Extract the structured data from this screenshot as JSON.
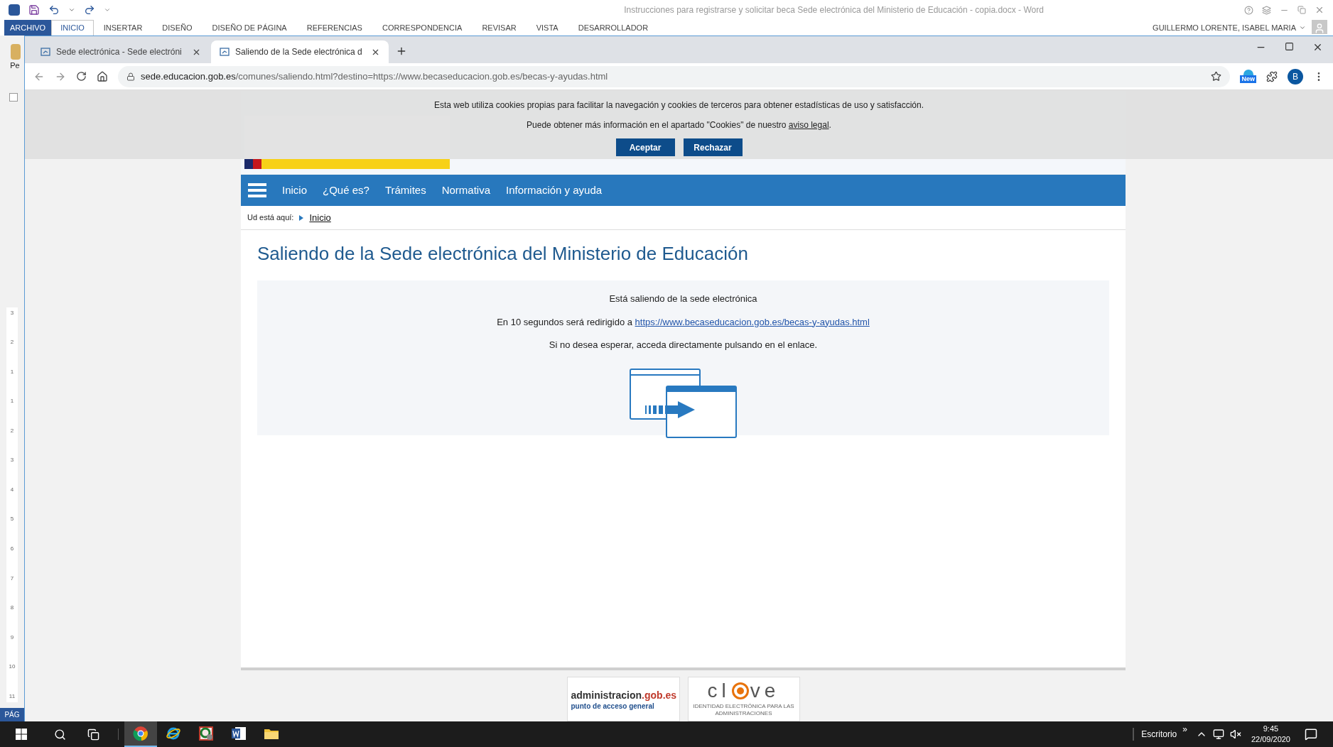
{
  "word": {
    "title": "Instrucciones para registrarse y solicitar beca Sede electrónica del Ministerio de Educación - copia.docx - Word",
    "ribbon_tabs": [
      {
        "label": "ARCHIVO",
        "kind": "file",
        "selected": false
      },
      {
        "label": "INICIO",
        "kind": "tab",
        "selected": true
      },
      {
        "label": "INSERTAR",
        "kind": "tab",
        "selected": false
      },
      {
        "label": "DISEÑO",
        "kind": "tab",
        "selected": false
      },
      {
        "label": "DISEÑO DE PÁGINA",
        "kind": "tab",
        "selected": false
      },
      {
        "label": "REFERENCIAS",
        "kind": "tab",
        "selected": false
      },
      {
        "label": "CORRESPONDENCIA",
        "kind": "tab",
        "selected": false
      },
      {
        "label": "REVISAR",
        "kind": "tab",
        "selected": false
      },
      {
        "label": "VISTA",
        "kind": "tab",
        "selected": false
      },
      {
        "label": "DESARROLLADOR",
        "kind": "tab",
        "selected": false
      }
    ],
    "user": "GUILLERMO LORENTE, ISABEL MARIA",
    "paste_label": "Pe",
    "ruler_marks": [
      "3",
      "2",
      "1",
      "1",
      "2",
      "3",
      "4",
      "5",
      "6",
      "7",
      "8",
      "9",
      "10",
      "11"
    ],
    "status": "PÁG"
  },
  "browser": {
    "tabs": [
      {
        "title": "Sede electrónica - Sede electróni",
        "selected": false
      },
      {
        "title": "Saliendo de la Sede electrónica d",
        "selected": true
      }
    ],
    "url_host": "sede.educacion.gob.es",
    "url_path": "/comunes/saliendo.html?destino=https://www.becaseducacion.gob.es/becas-y-ayudas.html",
    "extension_badge": "New",
    "profile": "B"
  },
  "page": {
    "cookie_banner": {
      "line1": "Esta web utiliza cookies propias para facilitar la navegación y cookies de terceros para obtener estadísticas de uso y satisfacción.",
      "line2": "Puede obtener más información en el apartado \"Cookies\" de nuestro ",
      "link": "aviso legal",
      "line2_end": ".",
      "buttons": [
        "Aceptar",
        "Rechazar"
      ]
    },
    "nav": [
      "Inicio",
      "¿Qué es?",
      "Trámites",
      "Normativa",
      "Información y ayuda"
    ],
    "breadcrumb": {
      "label": "Ud está aquí:",
      "link": "Inicio"
    },
    "title": "Saliendo de la Sede electrónica del Ministerio de Educación",
    "notice": {
      "heading": "Está saliendo de la sede electrónica",
      "redirect_before": "En 10 segundos será redirigido a ",
      "redirect_link": "https://www.becaseducacion.gob.es/becas-y-ayudas.html",
      "hint": "Si no desea esperar, acceda directamente pulsando en el enlace."
    },
    "partner_logos": {
      "admin_name": "administracion",
      "admin_domain": ".gob.es",
      "admin_sub": "punto de acceso general",
      "clave_left": "cl",
      "clave_right": "ve",
      "clave_sub": "IDENTIDAD ELECTRÓNICA PARA LAS ADMINISTRACIONES"
    }
  },
  "taskbar": {
    "apps": [
      {
        "kind": "chrome",
        "selected": true
      },
      {
        "kind": "ie",
        "selected": false
      },
      {
        "kind": "remote",
        "selected": false
      },
      {
        "kind": "word",
        "selected": false
      },
      {
        "kind": "explorer",
        "selected": false
      }
    ],
    "desktop_label": "Escritorio",
    "overflow": "»",
    "time": "9:45",
    "date": "22/09/2020"
  }
}
